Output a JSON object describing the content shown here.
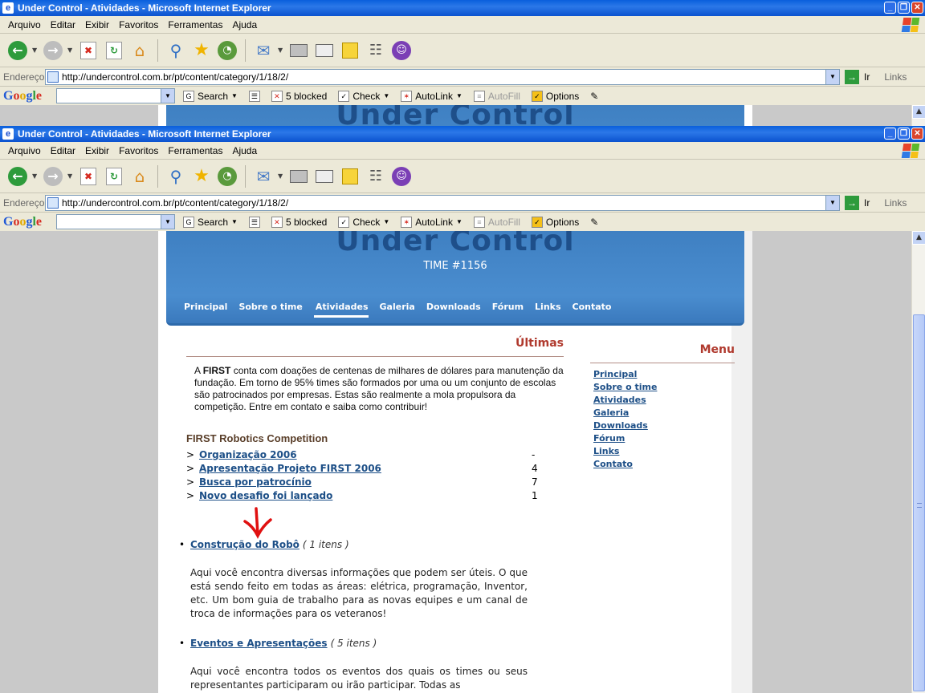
{
  "window": {
    "title": "Under Control - Atividades - Microsoft Internet Explorer",
    "title_btn_min": "_",
    "title_btn_max": "❐",
    "title_btn_close": "✕"
  },
  "menubar": [
    "Arquivo",
    "Editar",
    "Exibir",
    "Favoritos",
    "Ferramentas",
    "Ajuda"
  ],
  "address": {
    "label": "Endereço",
    "url": "http://undercontrol.com.br/pt/content/category/1/18/2/",
    "go_label": "Ir",
    "links_label": "Links"
  },
  "google_toolbar": {
    "logo": [
      "G",
      "o",
      "o",
      "g",
      "l",
      "e"
    ],
    "search_label": "Search",
    "blocked_label": "5 blocked",
    "check_label": "Check",
    "autolink_label": "AutoLink",
    "autofill_label": "AutoFill",
    "options_label": "Options"
  },
  "icons": {
    "back": "back-arrow-icon",
    "forward": "forward-arrow-icon",
    "stop": "stop-icon",
    "refresh": "refresh-icon",
    "home": "home-icon",
    "search": "search-icon",
    "favorites": "star-icon",
    "history": "history-icon",
    "mail": "mail-icon",
    "print": "printer-icon",
    "edit": "edit-icon",
    "discuss": "note-icon",
    "research": "research-icon",
    "messenger": "messenger-icon"
  },
  "site": {
    "title": "Under Control",
    "team": "TIME #1156",
    "nav": [
      "Principal",
      "Sobre o time",
      "Atividades",
      "Galeria",
      "Downloads",
      "Fórum",
      "Links",
      "Contato"
    ],
    "nav_active": "Atividades",
    "ultimas": "Últimas",
    "intro_pre": "A ",
    "intro_bold": "FIRST",
    "intro_post": " conta com doações de centenas de milhares de dólares para manutenção da fundação. Em torno de 95% times são formados por uma ou um conjunto de escolas são patrocinados por empresas. Estas são realmente a mola propulsora da competição. Entre em contato e saiba como contribuir!",
    "section_title": "FIRST Robotics Competition",
    "news": [
      {
        "title": "Organização 2006",
        "count": "-"
      },
      {
        "title": "Apresentação Projeto FIRST 2006",
        "count": "4"
      },
      {
        "title": "Busca por patrocínio",
        "count": "7"
      },
      {
        "title": "Novo desafio foi lançado",
        "count": "1"
      }
    ],
    "categories": [
      {
        "title": "Construção do Robô",
        "items": "( 1 itens )",
        "desc": "Aqui você encontra diversas informações que podem ser úteis. O que está sendo feito em todas as áreas: elétrica, programação, Inventor, etc. Um bom guia de trabalho para as novas equipes e um canal de troca de informações para os veteranos!"
      },
      {
        "title": "Eventos e Apresentações",
        "items": "( 5 itens )",
        "desc": "Aqui você encontra todos os eventos dos quais os times ou seus representantes participaram ou irão participar. Todas as"
      }
    ],
    "menu_title": "Menu",
    "menu": [
      "Principal",
      "Sobre o time",
      "Atividades",
      "Galeria",
      "Downloads",
      "Fórum",
      "Links",
      "Contato"
    ]
  },
  "colors": {
    "title_blue": "#0a5fdc",
    "header_blue": "#4a8dcf",
    "link_blue": "#1d4f87",
    "accent_red": "#b03a2e",
    "annotation_arrow": "#e01010"
  }
}
